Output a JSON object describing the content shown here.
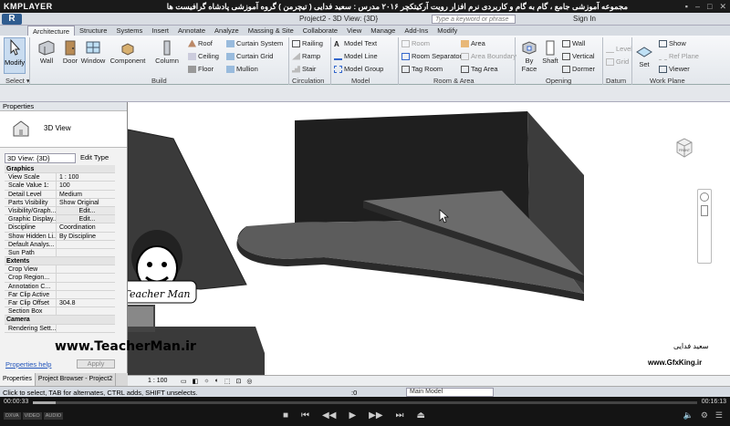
{
  "player": {
    "logo": "KMPLAYER",
    "title": "مجموعه آموزشی جامع ، گام به گام و کاربردی نرم افزار رویت آرکیتکچر ۲۰۱۶ مدرس : سعید فدایی ( تیچرمن ) گروه آموزشی پادشاه گرافیست ها",
    "time_elapsed": "00:00:33",
    "time_total": "00:16:13",
    "progress": 0.034,
    "tags": [
      "DXVA",
      "VIDEO",
      "AUDIO"
    ]
  },
  "revit": {
    "app_button": "R",
    "project_title": "Project2 - 3D View: {3D}",
    "search_placeholder": "Type a keyword or phrase",
    "sign_in": "Sign In"
  },
  "ribbon": {
    "tabs": [
      "Architecture",
      "Structure",
      "Systems",
      "Insert",
      "Annotate",
      "Analyze",
      "Massing & Site",
      "Collaborate",
      "View",
      "Manage",
      "Add-Ins",
      "Modify"
    ],
    "active_tab": "Architecture",
    "modify": "Modify",
    "select": "Select ▾",
    "build": {
      "wall": "Wall",
      "door": "Door",
      "window": "Window",
      "component": "Component",
      "column": "Column",
      "roof": "Roof",
      "ceiling": "Ceiling",
      "floor": "Floor",
      "curtain_system": "Curtain System",
      "curtain_grid": "Curtain Grid",
      "mullion": "Mullion",
      "label": "Build"
    },
    "circulation": {
      "railing": "Railing",
      "ramp": "Ramp",
      "stair": "Stair",
      "label": "Circulation"
    },
    "model": {
      "model_text": "Model Text",
      "model_line": "Model Line",
      "model_group": "Model Group",
      "label": "Model"
    },
    "room_area": {
      "room": "Room",
      "room_separator": "Room Separator",
      "tag_room": "Tag Room",
      "area": "Area",
      "area_boundary": "Area Boundary",
      "tag_area": "Tag Area",
      "label": "Room & Area"
    },
    "opening": {
      "by_face": "By Face",
      "shaft": "Shaft",
      "wall": "Wall",
      "vertical": "Vertical",
      "dormer": "Dormer",
      "label": "Opening"
    },
    "datum": {
      "level": "Level",
      "grid": "Grid",
      "label": "Datum"
    },
    "work_plane": {
      "set": "Set",
      "show": "Show",
      "ref_plane": "Ref Plane",
      "viewer": "Viewer",
      "label": "Work Plane"
    }
  },
  "properties": {
    "header": "Properties",
    "type_name": "3D View",
    "view_dropdown": "3D View: {3D}",
    "edit_type": "Edit Type",
    "rows": [
      {
        "k": "Graphics",
        "group": true
      },
      {
        "k": "View Scale",
        "v": "1 : 100"
      },
      {
        "k": "Scale Value 1:",
        "v": "100"
      },
      {
        "k": "Detail Level",
        "v": "Medium"
      },
      {
        "k": "Parts Visibility",
        "v": "Show Original"
      },
      {
        "k": "Visibility/Graph...",
        "v": "Edit...",
        "btn": true
      },
      {
        "k": "Graphic Display...",
        "v": "Edit...",
        "btn": true
      },
      {
        "k": "Discipline",
        "v": "Coordination"
      },
      {
        "k": "Show Hidden Li...",
        "v": "By Discipline"
      },
      {
        "k": "Default Analys...",
        "v": ""
      },
      {
        "k": "Sun Path",
        "v": ""
      },
      {
        "k": "Extents",
        "group": true
      },
      {
        "k": "Crop View",
        "v": ""
      },
      {
        "k": "Crop Region...",
        "v": ""
      },
      {
        "k": "Annotation C...",
        "v": ""
      },
      {
        "k": "Far Clip Active",
        "v": ""
      },
      {
        "k": "Far Clip Offset",
        "v": "304.8"
      },
      {
        "k": "Section Box",
        "v": ""
      },
      {
        "k": "Camera",
        "group": true
      },
      {
        "k": "Rendering Sett...",
        "v": ""
      }
    ],
    "help": "Properties help",
    "apply": "Apply",
    "tabs": [
      "Properties",
      "Project Browser - Project2"
    ]
  },
  "viewport": {
    "scale": "1 : 100",
    "navcube_label": "FRONT"
  },
  "status": {
    "text": "Click to select, TAB for alternates, CTRL adds, SHIFT unselects.",
    "model": "Main Model",
    "count": ":0"
  },
  "watermarks": {
    "url": "www.TeacherMan.ir",
    "gfx": "www.GfxKing.ir",
    "author_fa": "سعید فدایی",
    "teacher_fa": "تیچرمن",
    "teacher_en": "Teacher Man"
  }
}
